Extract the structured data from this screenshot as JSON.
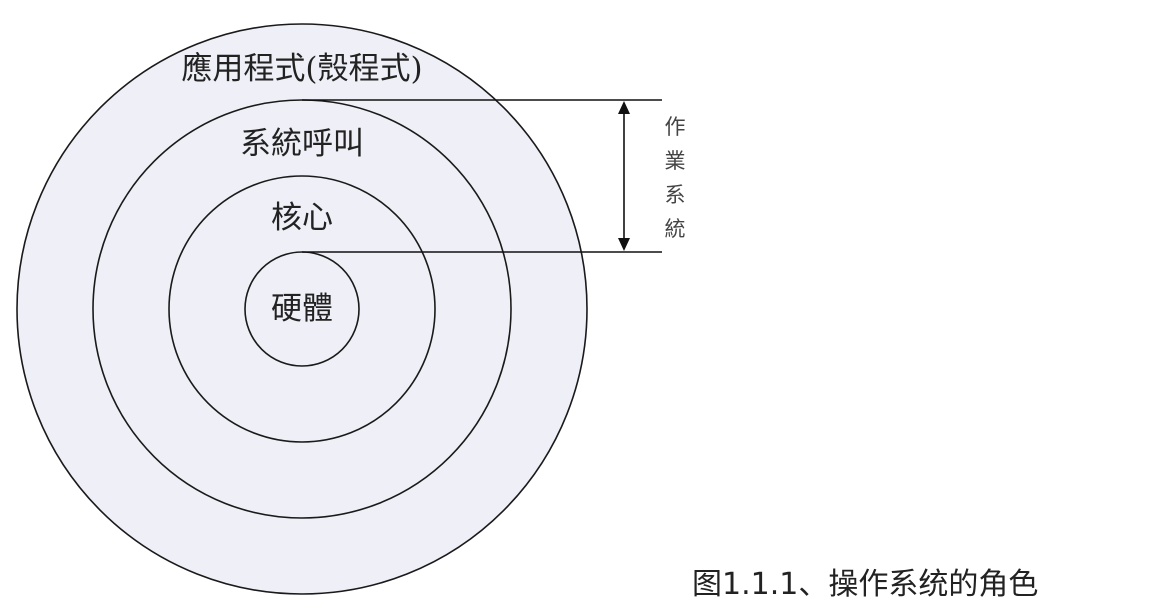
{
  "diagram": {
    "layers": [
      {
        "id": "application",
        "label": "應用程式(殼程式)"
      },
      {
        "id": "system-call",
        "label": "系統呼叫"
      },
      {
        "id": "kernel",
        "label": "核心"
      },
      {
        "id": "hardware",
        "label": "硬體"
      }
    ],
    "os_bracket": {
      "chars": [
        "作",
        "業",
        "系",
        "統"
      ]
    },
    "fill_color": "#eeeff7",
    "stroke_color": "#1a1a1a"
  },
  "caption": "图1.1.1、操作系统的角色"
}
